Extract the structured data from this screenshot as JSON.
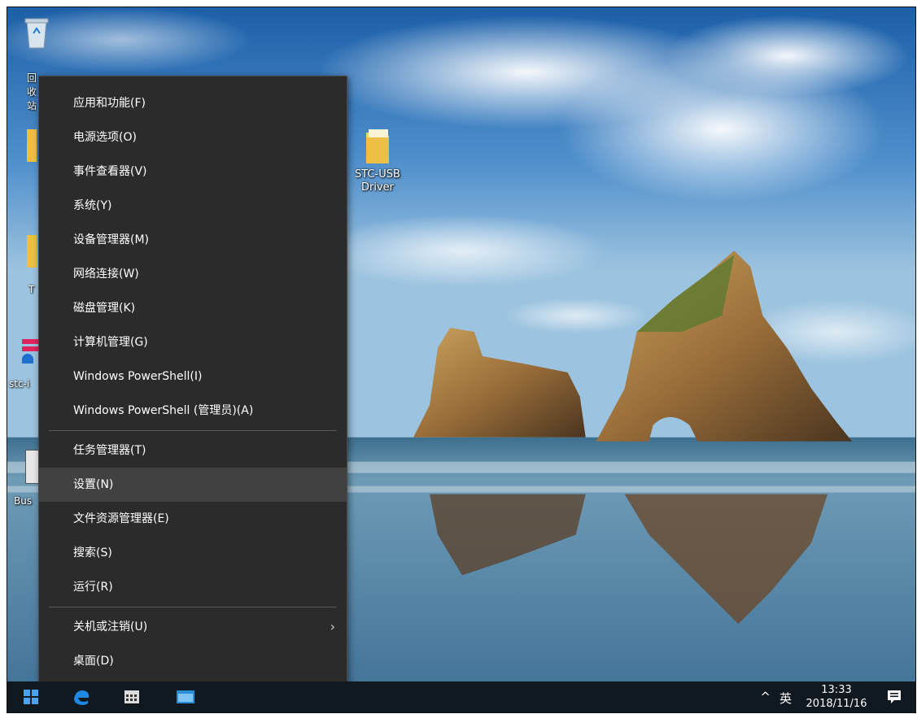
{
  "desktop": {
    "icons": {
      "stc_usb": {
        "label_line1": "STC-USB",
        "label_line2": "Driver"
      },
      "recycle_bin_partial": "回收站",
      "partial_left_1": "T",
      "partial_left_2": "stc-i",
      "partial_left_3": "Bus"
    }
  },
  "context_menu": {
    "items": [
      {
        "label": "应用和功能(F)"
      },
      {
        "label": "电源选项(O)"
      },
      {
        "label": "事件查看器(V)"
      },
      {
        "label": "系统(Y)"
      },
      {
        "label": "设备管理器(M)"
      },
      {
        "label": "网络连接(W)"
      },
      {
        "label": "磁盘管理(K)"
      },
      {
        "label": "计算机管理(G)"
      },
      {
        "label": "Windows PowerShell(I)"
      },
      {
        "label": "Windows PowerShell (管理员)(A)"
      },
      {
        "label": "任务管理器(T)"
      },
      {
        "label": "设置(N)"
      },
      {
        "label": "文件资源管理器(E)"
      },
      {
        "label": "搜索(S)"
      },
      {
        "label": "运行(R)"
      },
      {
        "label": "关机或注销(U)"
      },
      {
        "label": "桌面(D)"
      }
    ],
    "hovered_index": 11,
    "submenu_arrow": "›"
  },
  "taskbar": {
    "tray_chevron": "^",
    "ime": "英",
    "time": "13:33",
    "date": "2018/11/16"
  },
  "colors": {
    "menu_bg": "#2b2b2b",
    "menu_hover": "#414141",
    "taskbar_bg": "#101820",
    "accent": "#0078d7"
  }
}
